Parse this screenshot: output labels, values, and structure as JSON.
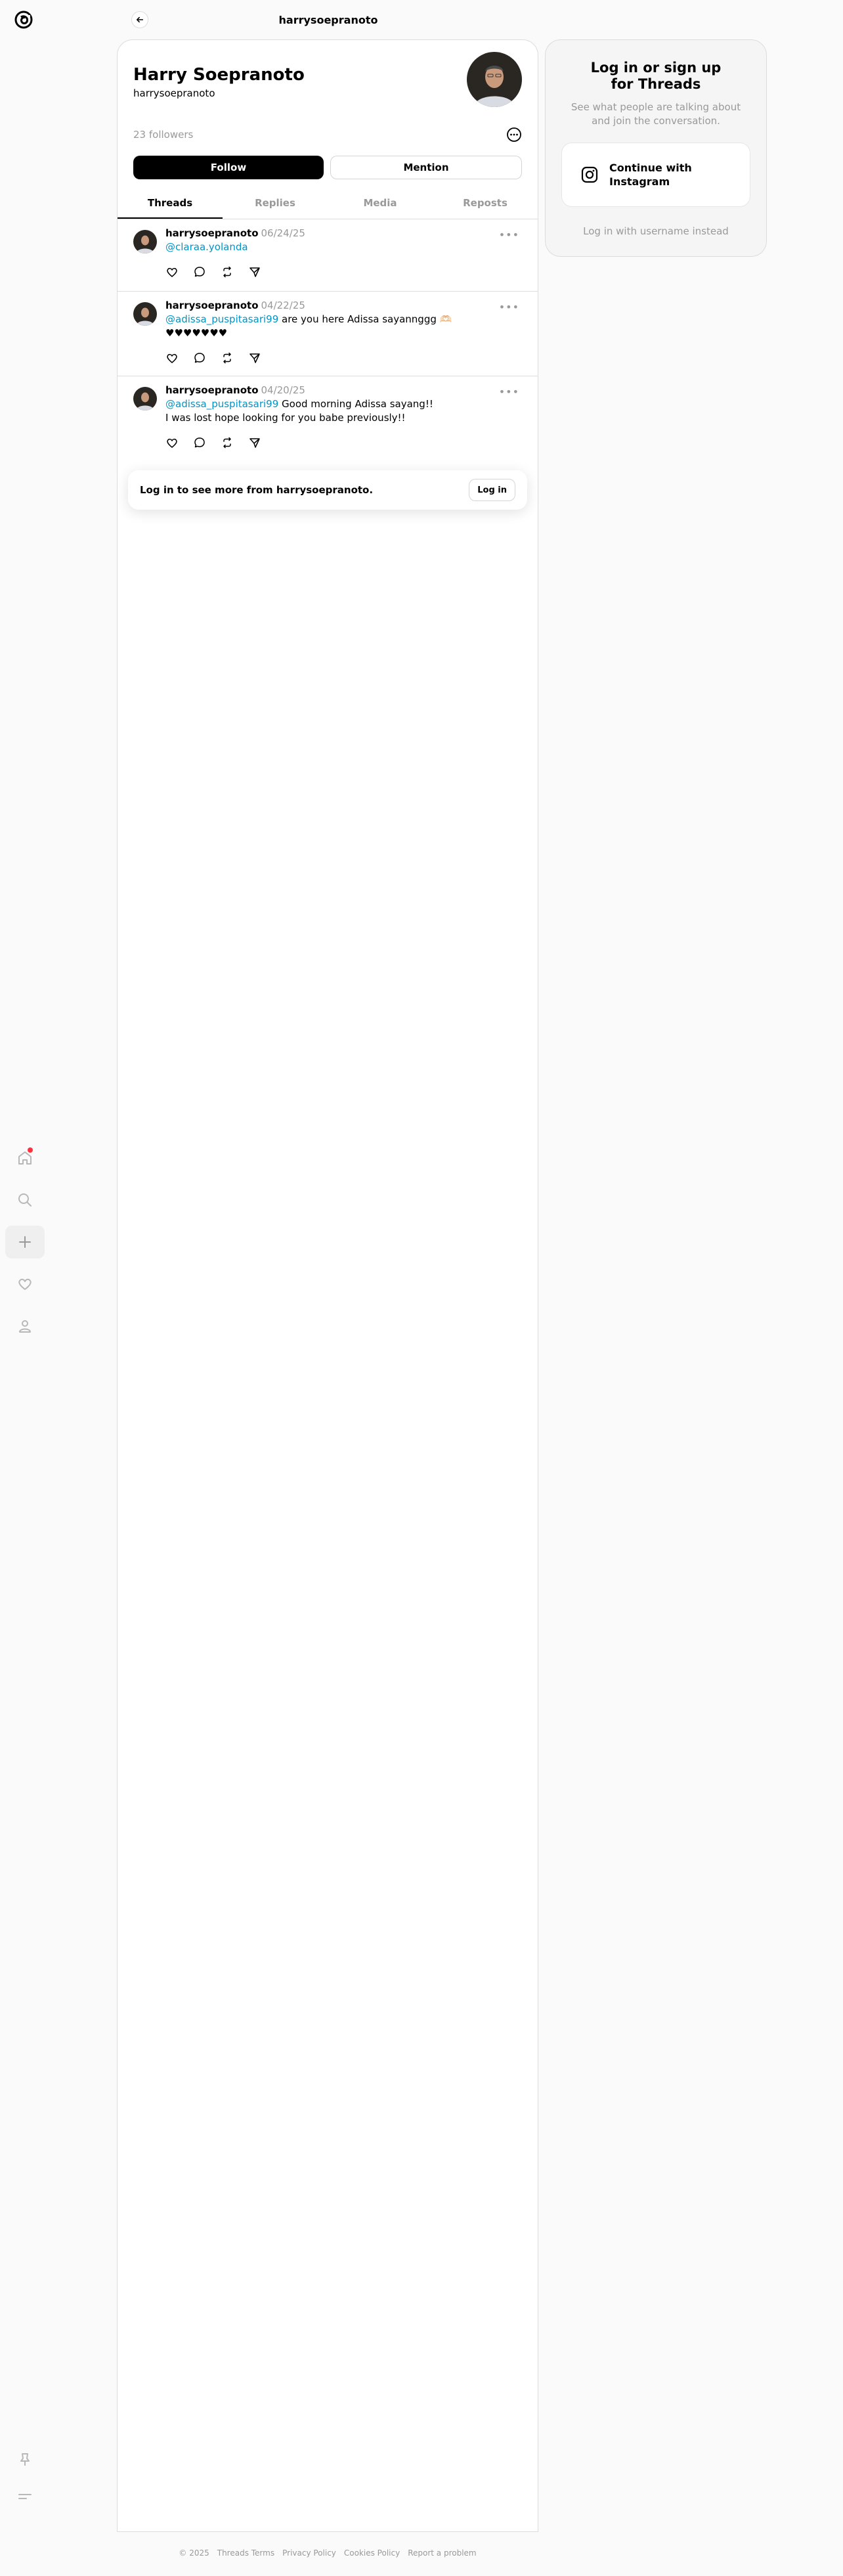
{
  "header": {
    "title": "harrysoepranoto"
  },
  "profile": {
    "name": "Harry Soepranoto",
    "username": "harrysoepranoto",
    "followers": "23 followers",
    "follow_label": "Follow",
    "mention_label": "Mention"
  },
  "tabs": [
    {
      "label": "Threads"
    },
    {
      "label": "Replies"
    },
    {
      "label": "Media"
    },
    {
      "label": "Reposts"
    }
  ],
  "posts": [
    {
      "user": "harrysoepranoto",
      "date": "06/24/25",
      "mention": "@claraa.yolanda",
      "text": ""
    },
    {
      "user": "harrysoepranoto",
      "date": "04/22/25",
      "mention": "@adissa_puspitasari99",
      "text": " are you here Adissa sayannggg 🫶🏻\n♥♥♥♥♥♥♥"
    },
    {
      "user": "harrysoepranoto",
      "date": "04/20/25",
      "mention": "@adissa_puspitasari99",
      "text": " Good morning Adissa sayang!!\nI was lost hope looking for you babe previously!!"
    }
  ],
  "login_card": {
    "text": "Log in to see more from harrysoepranoto.",
    "button": "Log in"
  },
  "right_panel": {
    "title": "Log in or sign up for Threads",
    "subtitle": "See what people are talking about and join the conversation.",
    "instagram_button": "Continue with Instagram",
    "alt_login": "Log in with username instead"
  },
  "footer": {
    "links": [
      "© 2025",
      "Threads Terms",
      "Privacy Policy",
      "Cookies Policy",
      "Report a problem"
    ]
  },
  "colors": {
    "accent_link": "#0095c6",
    "notification_dot": "#ff3040"
  },
  "icons": {
    "rail": [
      "threads-logo",
      "home-icon",
      "search-icon",
      "create-icon",
      "heart-icon",
      "profile-icon",
      "pin-icon",
      "menu-icon"
    ],
    "actions": [
      "heart-icon",
      "comment-icon",
      "repost-icon",
      "share-icon"
    ]
  }
}
